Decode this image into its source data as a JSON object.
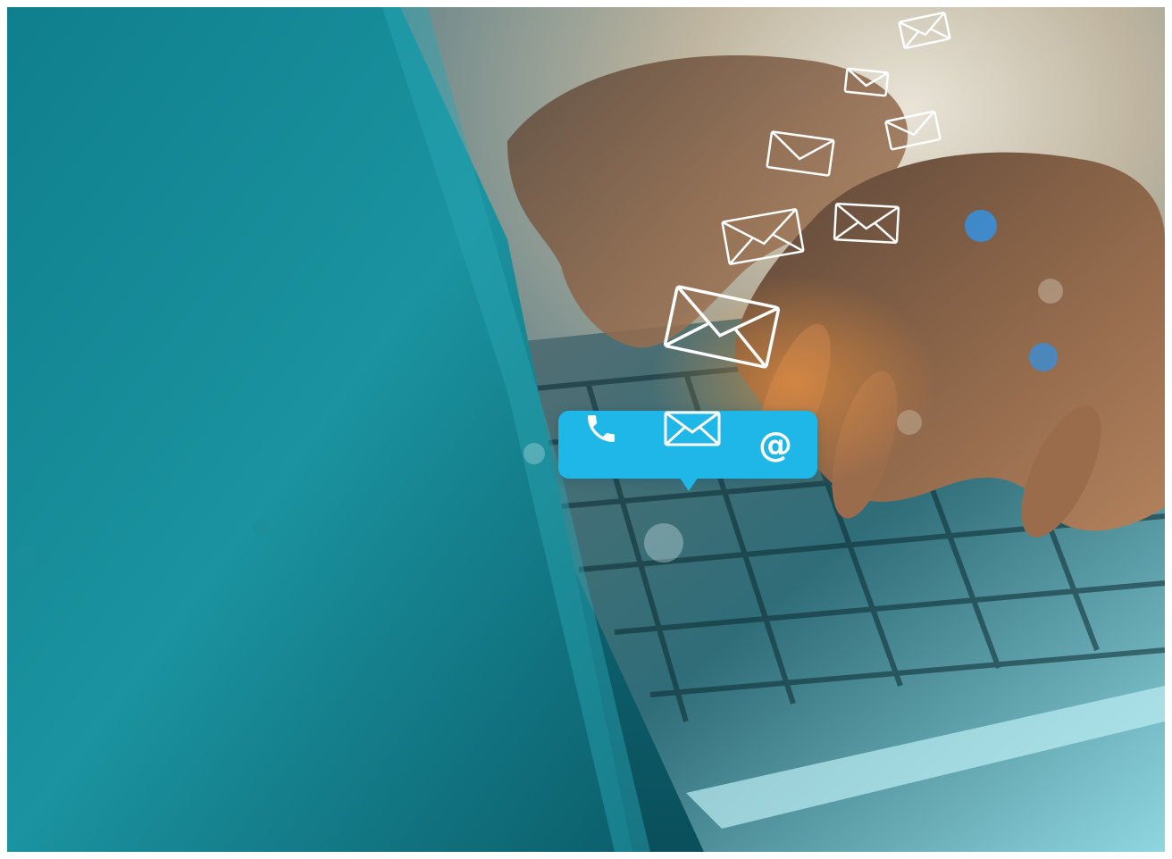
{
  "scene": {
    "description_icons": [
      "phone-icon",
      "envelope-icon",
      "at-sign-icon"
    ],
    "accent_color": "#1fb6e8",
    "at_symbol": "@"
  }
}
